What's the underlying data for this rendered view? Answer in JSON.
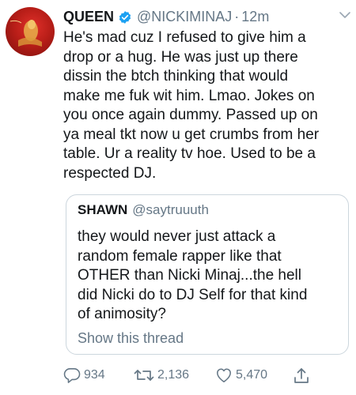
{
  "tweet": {
    "author_name": "QUEEN",
    "handle": "@NICKIMINAJ",
    "separator": "·",
    "time": "12m",
    "text": "He's mad cuz I refused to give him a\ndrop or a hug. He was just up there\ndissin the btch thinking that would\nmake me fuk wit him. Lmao. Jokes on\nyou once again dummy. Passed up on\nya meal tkt now u get crumbs from her\ntable. Ur a reality tv hoe. Used to be a\nrespected DJ.",
    "verified": true
  },
  "quote": {
    "author_name": "SHAWN",
    "handle": "@saytruuuth",
    "text": "they would never just attack a\nrandom female rapper like that\nOTHER than Nicki Minaj...the hell\ndid Nicki do to DJ Self for that kind\nof animosity?",
    "show_thread": "Show this thread"
  },
  "actions": {
    "replies": "934",
    "retweets": "2,136",
    "likes": "5,470"
  },
  "icons": {
    "verified": "verified-badge-icon",
    "caret": "chevron-down-icon",
    "reply": "reply-icon",
    "retweet": "retweet-icon",
    "like": "heart-icon",
    "share": "share-icon"
  },
  "colors": {
    "verified": "#1da1f2",
    "secondary_text": "#657786",
    "quote_border": "#ccd6dd"
  }
}
